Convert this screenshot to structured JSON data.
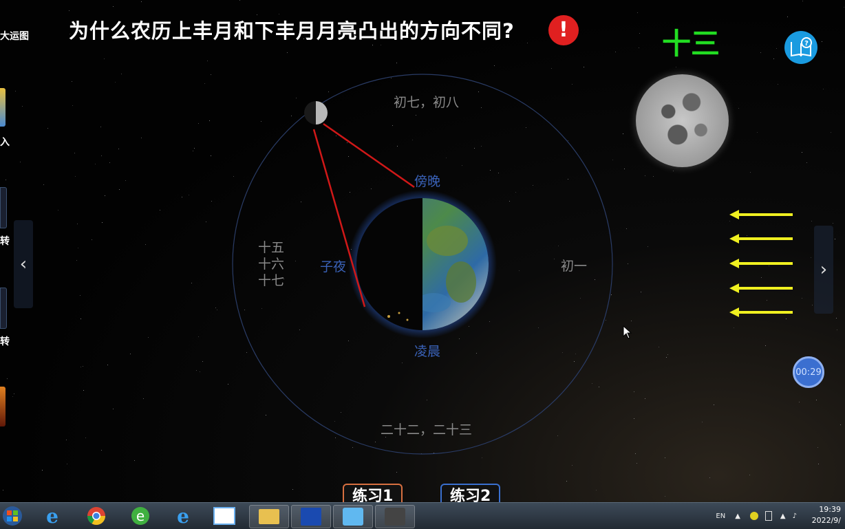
{
  "header": {
    "title": "为什么农历上丰月和下丰月月亮凸出的方向不同?",
    "alert_symbol": "!"
  },
  "sidebar": {
    "title": "大运图",
    "labels": [
      "入",
      "转",
      "转"
    ]
  },
  "right_panel": {
    "lunar_day": "十三",
    "timer": "00:29"
  },
  "orbit_labels": {
    "top": "初七，初八",
    "right": "初一",
    "bottom": "二十二，二十三",
    "left_lines": [
      "十五",
      "十六",
      "十七"
    ]
  },
  "time_labels": {
    "dusk": "傍晚",
    "midnight": "子夜",
    "dawn": "凌晨"
  },
  "practice": {
    "btn1": "练习1",
    "btn2": "练习2"
  },
  "taskbar": {
    "lang": "EN",
    "time": "19:39",
    "date": "2022/9/"
  },
  "icons": {
    "alert": "alert-icon",
    "help": "help-book-icon",
    "nav_prev": "chevron-left-icon",
    "nav_next": "chevron-right-icon",
    "sunlight_arrows": "arrow-left-icon"
  },
  "colors": {
    "lunar_day": "#22dd22",
    "alert": "#e02020",
    "help": "#1a9be0",
    "time_label": "#3a62b8",
    "orbit_label": "#8a8a8a",
    "sight_line": "#d01818",
    "sun_arrow": "#f0f020"
  }
}
